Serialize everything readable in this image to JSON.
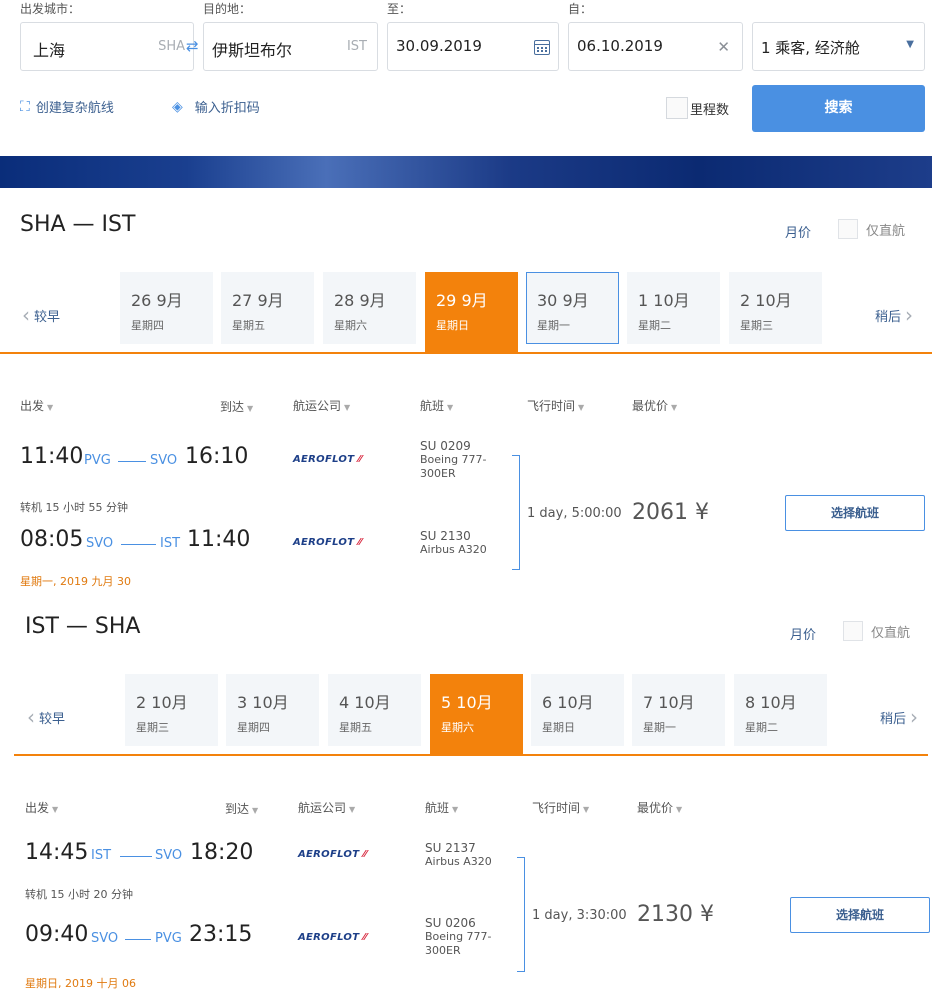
{
  "search": {
    "origin_label": "出发城市：",
    "origin_value": "上海",
    "origin_code": "SHA",
    "destination_label": "目的地：",
    "destination_value": "伊斯坦布尔",
    "destination_code": "IST",
    "depart_label": "至：",
    "depart_value": "30.09.2019",
    "return_label": "自：",
    "return_value": "06.10.2019",
    "passengers_value": "1 乘客, 经济舱",
    "complex_route_label": "创建复杂航线",
    "promo_label": "输入折扣码",
    "miles_label": "里程数",
    "search_button": "搜索"
  },
  "common": {
    "month_price": "月价",
    "direct_only": "仅直航",
    "earlier": "较早",
    "later": "稍后",
    "select_flight": "选择航班",
    "airline_logo_text": "AEROFLOT",
    "columns": {
      "depart": "出发",
      "arrive": "到达",
      "airline": "航运公司",
      "flight": "航班",
      "duration": "飞行时间",
      "best_price": "最优价"
    },
    "colors": {
      "accent": "#4a90e2",
      "active_tab": "#f3820c",
      "date_note": "#e07a10"
    }
  },
  "outbound": {
    "title": "SHA — IST",
    "dates": [
      {
        "date": "26 9月",
        "weekday": "星期四"
      },
      {
        "date": "27 9月",
        "weekday": "星期五"
      },
      {
        "date": "28 9月",
        "weekday": "星期六"
      },
      {
        "date": "29 9月",
        "weekday": "星期日"
      },
      {
        "date": "30 9月",
        "weekday": "星期一"
      },
      {
        "date": "1 10月",
        "weekday": "星期二"
      },
      {
        "date": "2 10月",
        "weekday": "星期三"
      }
    ],
    "leg1": {
      "dep_time": "11:40",
      "dep_airport": "PVG",
      "arr_airport": "SVO",
      "arr_time": "16:10",
      "flight_no": "SU 0209",
      "aircraft": "Boeing 777-300ER"
    },
    "layover": "转机 15 小时 55 分钟",
    "leg2": {
      "dep_time": "08:05",
      "dep_airport": "SVO",
      "arr_airport": "IST",
      "arr_time": "11:40",
      "flight_no": "SU 2130",
      "aircraft": "Airbus A320"
    },
    "duration": "1 day, 5:00:00",
    "price": "2061 ¥",
    "date_note": "星期一, 2019 九月 30"
  },
  "inbound": {
    "title": "IST — SHA",
    "dates": [
      {
        "date": "2 10月",
        "weekday": "星期三"
      },
      {
        "date": "3 10月",
        "weekday": "星期四"
      },
      {
        "date": "4 10月",
        "weekday": "星期五"
      },
      {
        "date": "5 10月",
        "weekday": "星期六"
      },
      {
        "date": "6 10月",
        "weekday": "星期日"
      },
      {
        "date": "7 10月",
        "weekday": "星期一"
      },
      {
        "date": "8 10月",
        "weekday": "星期二"
      }
    ],
    "leg1": {
      "dep_time": "14:45",
      "dep_airport": "IST",
      "arr_airport": "SVO",
      "arr_time": "18:20",
      "flight_no": "SU 2137",
      "aircraft": "Airbus A320"
    },
    "layover": "转机 15 小时 20 分钟",
    "leg2": {
      "dep_time": "09:40",
      "dep_airport": "SVO",
      "arr_airport": "PVG",
      "arr_time": "23:15",
      "flight_no": "SU 0206",
      "aircraft": "Boeing 777-300ER"
    },
    "duration": "1 day, 3:30:00",
    "price": "2130 ¥",
    "date_note": "星期日, 2019 十月 06"
  }
}
